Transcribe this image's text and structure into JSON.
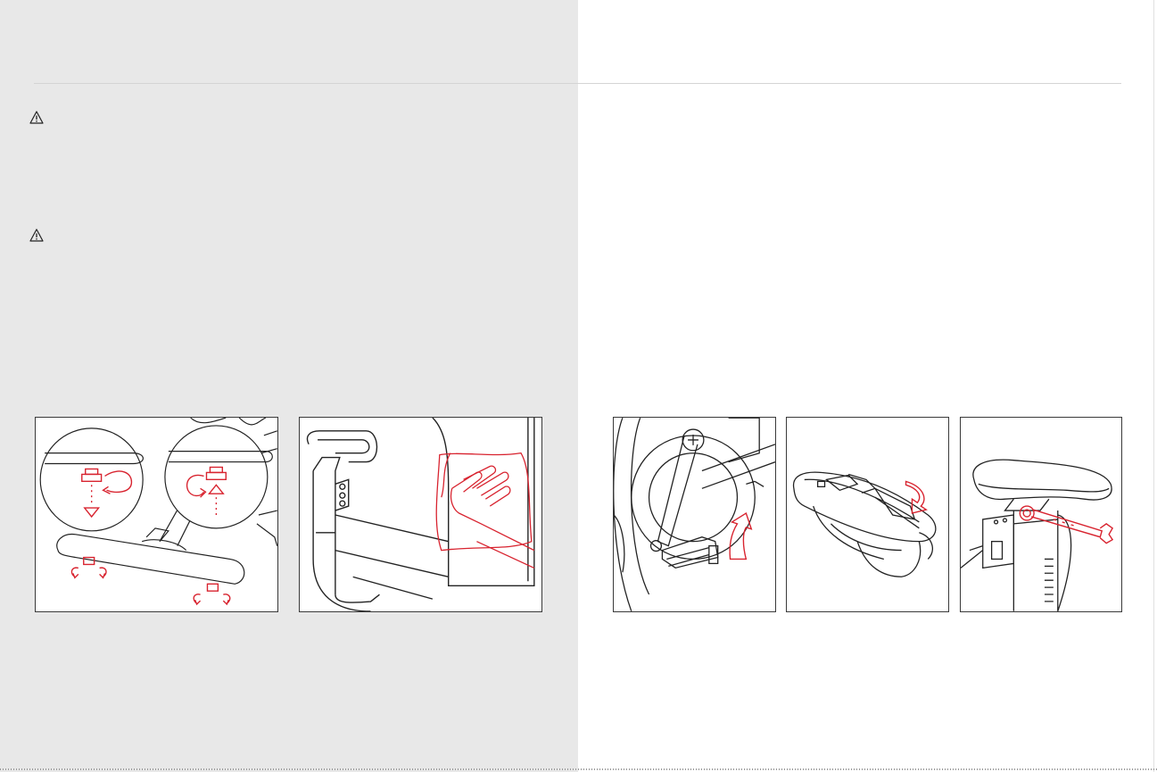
{
  "page": {
    "left_background": "#e8e8e8",
    "right_background": "#ffffff",
    "rule_color": "#d4d4d4"
  },
  "icons": {
    "warning_1": "warning-triangle-icon",
    "warning_2": "warning-triangle-icon"
  },
  "figures": [
    {
      "name": "leveling-feet-illustration",
      "icon": "leveling-foot-adjust"
    },
    {
      "name": "wipe-screen-illustration",
      "icon": "cloth-wipe"
    },
    {
      "name": "pedal-tighten-illustration",
      "icon": "pedal-rotate"
    },
    {
      "name": "saddle-clean-illustration",
      "icon": "saddle-wipe"
    },
    {
      "name": "seat-bolt-wrench-illustration",
      "icon": "wrench"
    }
  ],
  "colors": {
    "accent_red": "#d8232f",
    "line_art": "#222222"
  }
}
